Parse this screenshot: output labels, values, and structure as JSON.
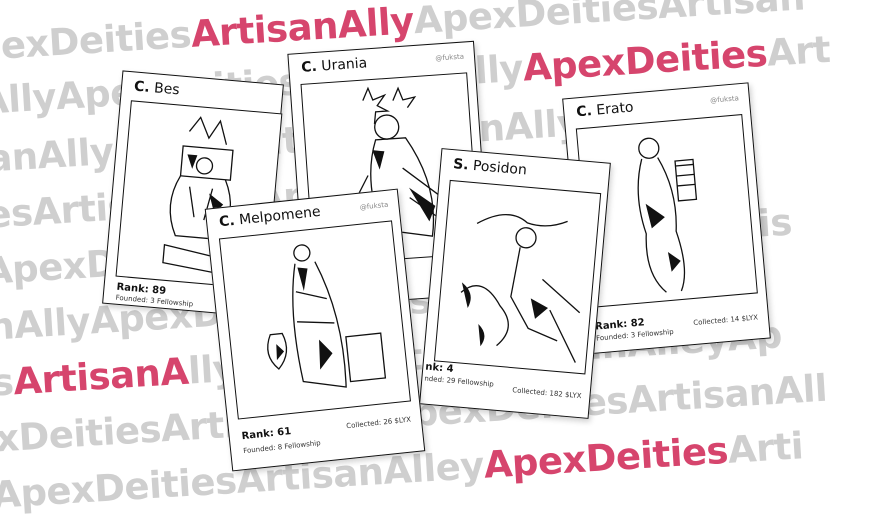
{
  "background": {
    "rows": [
      [
        "ApexDeities",
        "ArtisanAlly",
        "ApexDeitiesArtisan"
      ],
      [
        "AllyApexDeitiesArtisanAlly",
        "ApexDeities",
        "Art"
      ],
      [
        "isanAllyApexDeitiesArtisanAllyApexDei"
      ],
      [
        "tiesArtisanAllyApexDeitiesArtisanAlle"
      ],
      [
        "yApexDeitiesArtisanAllyApexDeitiesArtis"
      ],
      [
        "anAllyApexDeitiesArtisanAllyApexDeiti"
      ],
      [
        "es",
        "ArtisanA",
        "llyApexDeitiesArtisanAlleyAp"
      ],
      [
        "exDeitiesArtisanAllyApexDeitiesArtisanAll"
      ],
      [
        "eyApexDeitiesArtisanAlley",
        "ApexDeities",
        "Arti"
      ]
    ],
    "highlight_color": "#d6456d",
    "text_color": "#cfcfcf"
  },
  "cards": [
    {
      "prefix": "C.",
      "name": "Bes",
      "handle": "",
      "rank": "Rank: 89",
      "founded": "Founded: 3 Fellowship",
      "collected": "Col"
    },
    {
      "prefix": "C.",
      "name": "Urania",
      "handle": "@fuksta",
      "rank": "",
      "founded": "",
      "collected": ""
    },
    {
      "prefix": "C.",
      "name": "Melpomene",
      "handle": "@fuksta",
      "rank": "Rank: 61",
      "founded": "Founded: 8 Fellowship",
      "collected": "Collected: 26 $LYX"
    },
    {
      "prefix": "S.",
      "name": "Posidon",
      "handle": "",
      "rank": "nk: 4",
      "founded": "nded: 29 Fellowship",
      "collected": "Collected: 182 $LYX"
    },
    {
      "prefix": "C.",
      "name": "Erato",
      "handle": "@fuksta",
      "rank": "Rank: 82",
      "founded": "Founded: 3 Fellowship",
      "collected": "Collected: 14 $LYX"
    }
  ]
}
